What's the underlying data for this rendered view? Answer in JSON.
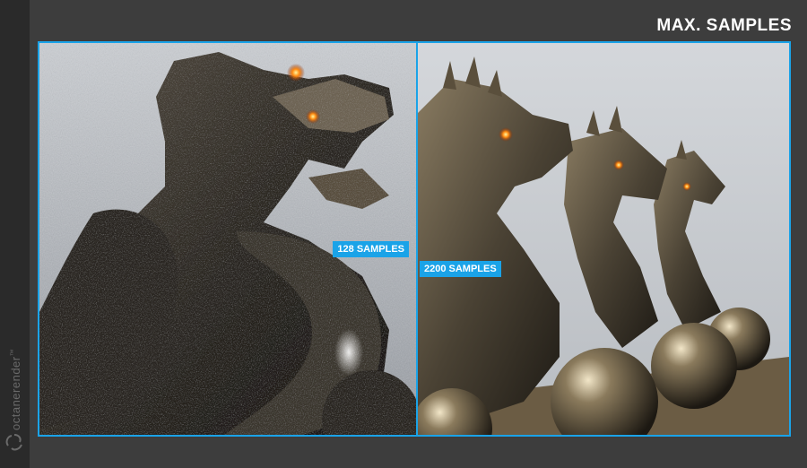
{
  "header": {
    "title": "MAX. SAMPLES"
  },
  "sidebar": {
    "brand": "octanerender",
    "brand_mark": "™",
    "logo_icon": "octane-logo-icon"
  },
  "comparison": {
    "left_label": "128 SAMPLES",
    "right_label": "2200 SAMPLES"
  },
  "colors": {
    "accent": "#1aa3e8",
    "background": "#3d3d3d",
    "sidebar": "#2a2a2a"
  }
}
